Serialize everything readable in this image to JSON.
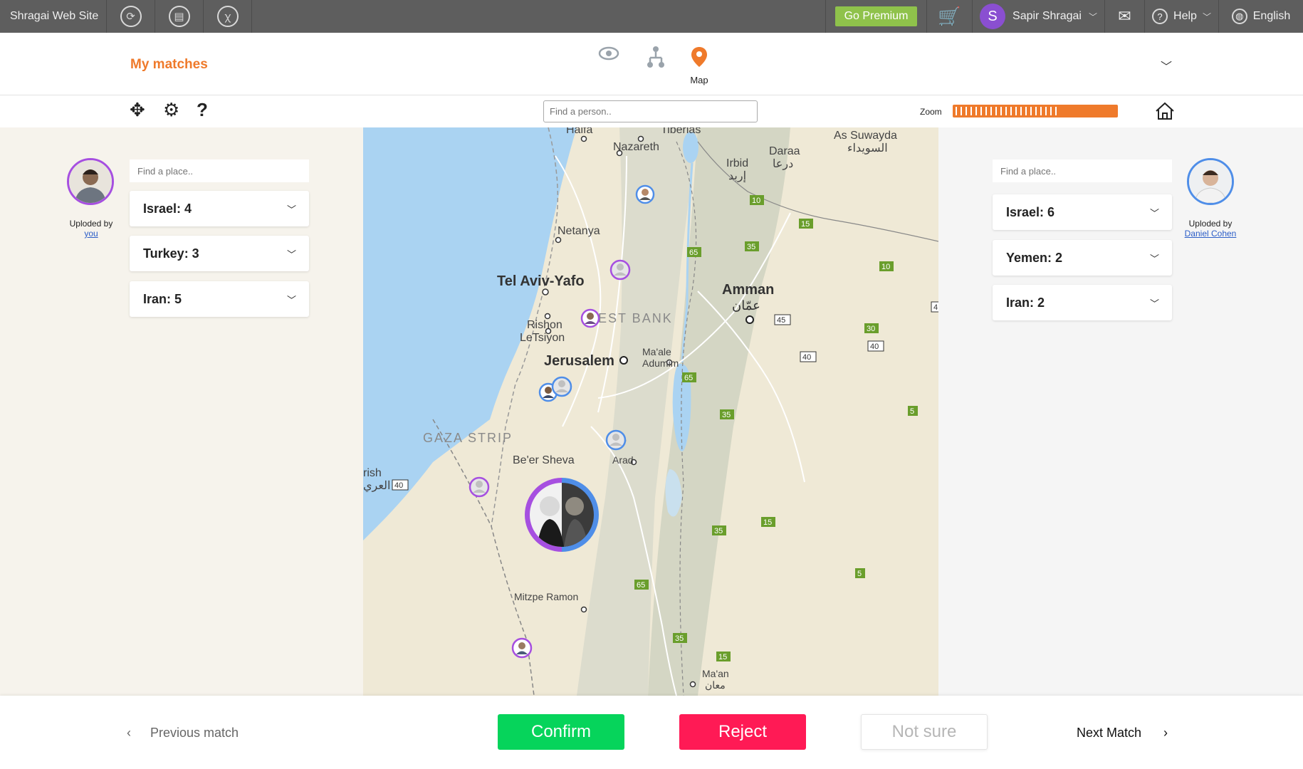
{
  "topbar": {
    "site_name": "Shragai Web Site",
    "premium_label": "Go Premium",
    "user_initial": "S",
    "user_name": "Sapir Shragai",
    "help_label": "Help",
    "language_label": "English"
  },
  "header": {
    "title": "My matches",
    "map_label": "Map"
  },
  "toolbar": {
    "person_search_placeholder": "Find a person..",
    "zoom_label": "Zoom",
    "zoom_level": 0.65
  },
  "left_panel": {
    "uploaded_by_label": "Uploded by",
    "uploader": "you",
    "place_placeholder": "Find a place..",
    "countries": [
      "Israel: 4",
      "Turkey: 3",
      "Iran: 5"
    ]
  },
  "right_panel": {
    "uploaded_by_label": "Uploded by",
    "uploader": "Daniel Cohen",
    "place_placeholder": "Find a place..",
    "countries": [
      "Israel: 6",
      "Yemen: 2",
      "Iran: 2"
    ]
  },
  "map": {
    "places": {
      "haifa": "Haifa",
      "tiberias": "Tiberias",
      "nazareth": "Nazareth",
      "as_suwayda": "As Suwayda",
      "as_suwayda_ar": "السويداء",
      "daraa": "Daraa",
      "daraa_ar": "درعا",
      "irbid": "Irbid",
      "irbid_ar": "إربد",
      "netanya": "Netanya",
      "tel_aviv": "Tel Aviv-Yafo",
      "amman": "Amman",
      "amman_ar": "عمّان",
      "rishon": "Rishon",
      "letsiyon": "LeTsiyon",
      "west_bank": "EST BANK",
      "maale": "Ma'ale",
      "adumim": "Adumim",
      "jerusalem": "Jerusalem",
      "gaza": "GAZA STRIP",
      "beer_sheva": "Be'er Sheva",
      "arad": "Arad",
      "arish": "rish",
      "arish_ar": "العري",
      "mitzpe_ramon": "Mitzpe Ramon",
      "maan": "Ma'an",
      "maan_ar": "معان"
    },
    "road_shields": [
      "10",
      "15",
      "35",
      "65",
      "10",
      "45",
      "30",
      "40",
      "40",
      "65",
      "35",
      "5",
      "35",
      "15",
      "5",
      "65",
      "35",
      "15",
      "40",
      "4"
    ]
  },
  "colors": {
    "accent_orange": "#ef7a2b",
    "premium_green": "#8fc24b",
    "confirm_green": "#06d45b",
    "reject_red": "#ff1a55",
    "marker_purple": "#a64fe0",
    "marker_blue": "#4f8ee8"
  },
  "bottom": {
    "prev_label": "Previous match",
    "confirm_label": "Confirm",
    "reject_label": "Reject",
    "not_sure_label": "Not sure",
    "next_label": "Next Match"
  }
}
